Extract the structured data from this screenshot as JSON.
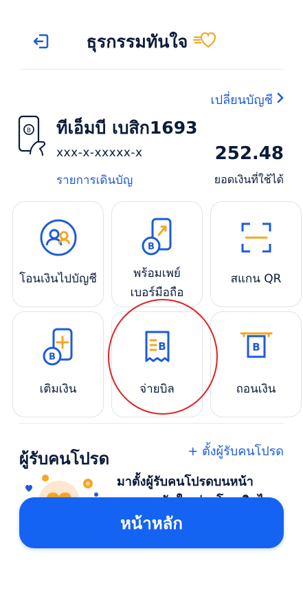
{
  "header": {
    "title": "ธุรกรรมทันใจ"
  },
  "account": {
    "change_label": "เปลี่ยนบัญชี",
    "name": "ทีเอ็มบี เบสิก1693",
    "number": "xxx-x-xxxxx-x",
    "statement_label": "รายการเดินบัญ",
    "balance": "252.48",
    "balance_label": "ยอดเงินที่ใช้ได้"
  },
  "actions": [
    {
      "label": "โอนเงินไปบัญชี"
    },
    {
      "label_line1": "พร้อมเพย์",
      "label_line2": "เบอร์มือถือ"
    },
    {
      "label": "สแกน QR"
    },
    {
      "label": "เติมเงิน"
    },
    {
      "label": "จ่ายบิล"
    },
    {
      "label": "ถอนเงิน"
    }
  ],
  "favorites": {
    "title": "ผู้รับคนโปรด",
    "add_label": "+ ตั้งผู้รับคนโปรด",
    "promo_line1": "มาตั้งผู้รับคนโปรดบนหน้า",
    "promo_line2": "ธุรกรรมทันใจ ช่วยโอนเงินไว"
  },
  "home_button": {
    "label": "หน้าหลัก"
  },
  "colors": {
    "primary": "#1463f3",
    "accent_orange": "#f5a623",
    "highlight": "#e32020"
  }
}
